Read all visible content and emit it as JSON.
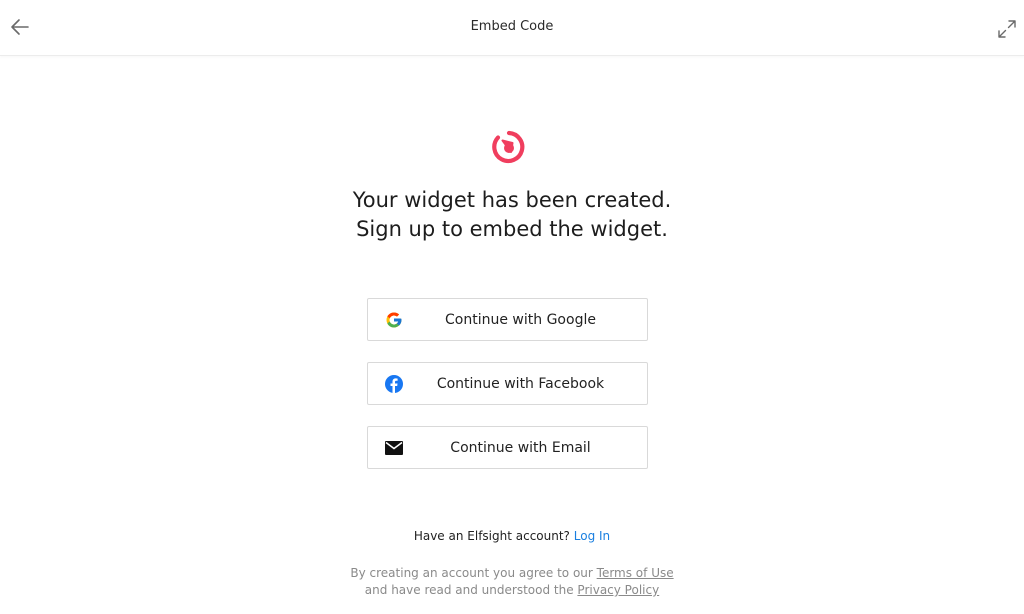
{
  "header": {
    "title": "Embed Code",
    "back_icon": "arrow-left-icon",
    "expand_icon": "expand-icon"
  },
  "main": {
    "logo_icon": "elfsight-logo-icon",
    "headline_line1": "Your widget has been created.",
    "headline_line2": "Sign up to embed the widget."
  },
  "auth": {
    "google_label": "Continue with Google",
    "facebook_label": "Continue with Facebook",
    "email_label": "Continue with Email"
  },
  "login": {
    "prompt": "Have an Elfsight account?",
    "link": "Log In"
  },
  "legal": {
    "line1_prefix": "By creating an account you agree to our",
    "terms_link": "Terms of Use",
    "line2_prefix": "and have read and understood the",
    "privacy_link": "Privacy Policy"
  },
  "colors": {
    "brand": "#f03e5e",
    "link": "#1a7fe0",
    "facebook": "#1877f2"
  }
}
